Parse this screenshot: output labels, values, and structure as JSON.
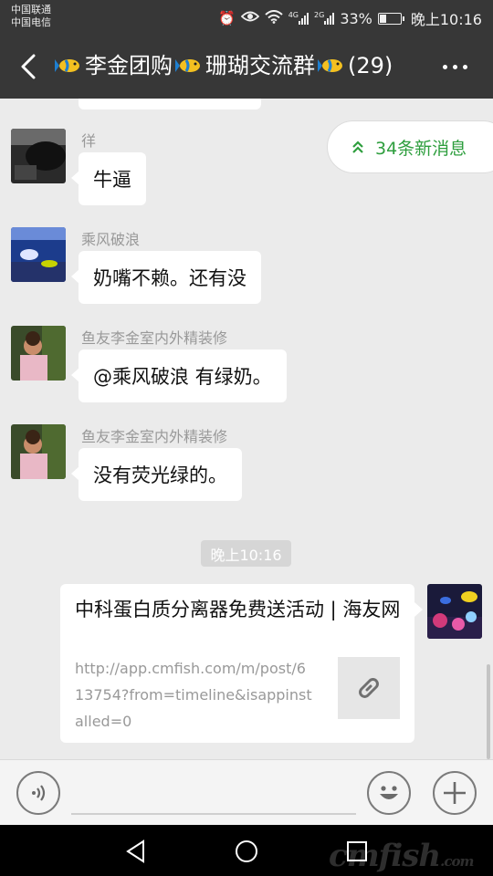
{
  "status_bar": {
    "carrier_1": "中国联通",
    "carrier_2": "中国电信",
    "network_1": "4G",
    "network_2": "2G",
    "battery": "33%",
    "battery_level": 0.33,
    "time": "晚上10:16"
  },
  "header": {
    "title_part1": "李金团购",
    "title_part2": "珊瑚交流群",
    "title_count": "(29)",
    "back_icon": "back-arrow-icon",
    "more_icon": "more-dots-icon"
  },
  "new_messages": {
    "label": "34条新消息",
    "icon": "double-chevron-up-icon"
  },
  "messages": [
    {
      "sender": "徉",
      "text": "牛逼"
    },
    {
      "sender": "乘风破浪",
      "text": "奶嘴不赖。还有没"
    },
    {
      "sender": "鱼友李金室内外精装修",
      "text": "@乘风破浪  有绿奶。"
    },
    {
      "sender": "鱼友李金室内外精装修",
      "text": "没有荧光绿的。"
    }
  ],
  "timestamp": "晚上10:16",
  "link_card": {
    "title": "中科蛋白质分离器免费送活动 | 海友网",
    "url": "http://app.cmfish.com/m/post/613754?from=timeline&isappinstalled=0",
    "thumb_icon": "link-icon"
  },
  "input_bar": {
    "voice_icon": "voice-icon",
    "emoji_icon": "emoji-icon",
    "plus_icon": "plus-icon"
  },
  "watermark": {
    "brand": "cmfish",
    "suffix": ".com"
  },
  "colors": {
    "header_bg": "#373737",
    "chat_bg": "#ebebeb",
    "accent_green": "#2e9e3e"
  }
}
